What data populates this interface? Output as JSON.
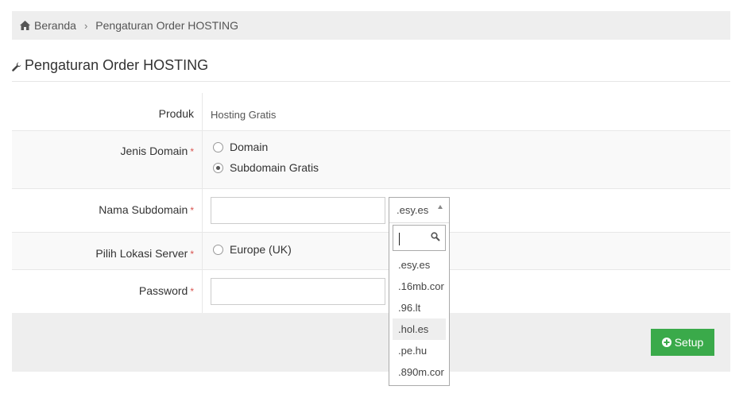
{
  "breadcrumb": {
    "home_icon": "home-icon",
    "home_label": "Beranda",
    "separator": "›",
    "current": "Pengaturan Order HOSTING"
  },
  "page": {
    "title_icon": "wrench-icon",
    "title": "Pengaturan Order HOSTING"
  },
  "form": {
    "produk": {
      "label": "Produk",
      "value": "Hosting Gratis"
    },
    "jenis_domain": {
      "label": "Jenis Domain",
      "required": "*",
      "options": [
        {
          "label": "Domain",
          "checked": false
        },
        {
          "label": "Subdomain Gratis",
          "checked": true
        }
      ]
    },
    "nama_subdomain": {
      "label": "Nama Subdomain",
      "required": "*",
      "value": "",
      "suffix_selected": ".esy.es"
    },
    "lokasi_server": {
      "label": "Pilih Lokasi Server",
      "required": "*",
      "option": "Europe (UK)"
    },
    "password": {
      "label": "Password",
      "required": "*",
      "value": ""
    }
  },
  "dropdown": {
    "search_value": "",
    "search_icon": "search-icon",
    "items": [
      ".esy.es",
      ".16mb.cor",
      ".96.lt",
      ".hol.es",
      ".pe.hu",
      ".890m.cor"
    ],
    "highlighted": ".hol.es"
  },
  "actions": {
    "setup_icon": "plus-circle-icon",
    "setup_label": "Setup",
    "setup_color": "#3aaa4a"
  }
}
